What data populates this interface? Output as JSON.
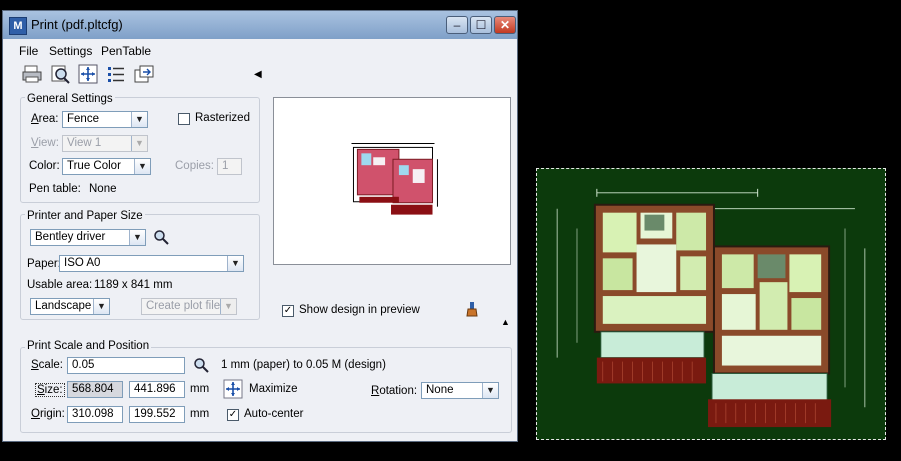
{
  "window": {
    "title": "Print  (pdf.pltcfg)",
    "app_icon": "M",
    "buttons": {
      "minimize": "–",
      "maximize": "☐",
      "close": "✕"
    }
  },
  "menu": {
    "file": "File",
    "settings": "Settings",
    "pentable": "PenTable"
  },
  "toolbar": {
    "icons": [
      "printer-icon",
      "preview-icon",
      "fit-icon",
      "list-icon",
      "export-icon"
    ],
    "collapse_arrow": "◀"
  },
  "general": {
    "title": "General Settings",
    "area_label": "Area:",
    "area_value": "Fence",
    "rasterized_label": "Rasterized",
    "view_label": "View:",
    "view_value": "View 1",
    "color_label": "Color:",
    "color_value": "True Color",
    "copies_label": "Copies:",
    "copies_value": "1",
    "pentable_label": "Pen table:",
    "pentable_value": "None"
  },
  "printer": {
    "title": "Printer and Paper Size",
    "driver_value": "Bentley driver",
    "paper_label": "Paper:",
    "paper_value": "ISO A0",
    "usable_label": "Usable area:",
    "usable_value": "1189 x 841 mm",
    "orientation_value": "Landscape",
    "plotfile_value": "Create plot file"
  },
  "preview": {
    "show_design_label": "Show design in preview",
    "show_design_checked": true,
    "expand_arrow": "▲"
  },
  "scale": {
    "title": "Print Scale and Position",
    "scale_label": "Scale:",
    "scale_value": "0.05",
    "scale_desc": "1 mm (paper) to 0.05 M (design)",
    "size_label": "Size:",
    "size_x": "568.804",
    "size_y": "441.896",
    "size_unit": "mm",
    "maximize_label": "Maximize",
    "rotation_label": "Rotation:",
    "rotation_value": "None",
    "origin_label": "Origin:",
    "origin_x": "310.098",
    "origin_y": "199.552",
    "origin_unit": "mm",
    "autocenter_label": "Auto-center",
    "autocenter_checked": true
  },
  "colors": {
    "background": "#000000",
    "cad_background": "#0c3a0c",
    "dialog_bg": "#eef0f5",
    "close_red": "#c23a22"
  }
}
